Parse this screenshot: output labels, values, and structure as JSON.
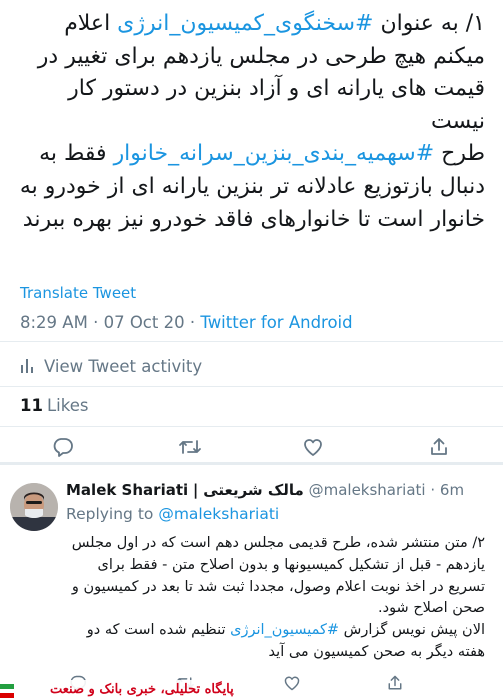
{
  "tweet": {
    "paragraphs": [
      [
        {
          "t": "۱/ به عنوان ",
          "tag": false
        },
        {
          "t": "#سخنگوی_کمیسیون_انرژی",
          "tag": true
        },
        {
          "t": " اعلام میکنم هیچ طرحی در مجلس یازدهم برای تغییر در قیمت های یارانه ای و آزاد بنزین در دستور کار نیست",
          "tag": false
        }
      ],
      [
        {
          "t": "طرح ",
          "tag": false
        },
        {
          "t": "#سهمیه_بندی_بنزین_سرانه_خانوار",
          "tag": true
        },
        {
          "t": " فقط به دنبال بازتوزیع عادلانه تر بنزین یارانه ای از خودرو به خانوار است تا خانوارهای فاقد خودرو نیز بهره ببرند",
          "tag": false
        }
      ]
    ],
    "translate_label": "Translate Tweet",
    "time": "8:29 AM",
    "date": "07 Oct 20",
    "source": "Twitter for Android",
    "activity_label": "View Tweet activity",
    "likes_count": "11",
    "likes_label": "Likes"
  },
  "reply": {
    "name": "Malek Shariati",
    "name_separator": "|",
    "name_fa": "مالک شریعتی",
    "handle": "@malekshariati",
    "age": "6m",
    "replying_to_label": "Replying to",
    "replying_to_handle": "@malekshariati",
    "paragraphs": [
      [
        {
          "t": "۲/ متن منتشر شده، طرح قدیمی مجلس دهم است که در اول مجلس یازدهم - قبل از تشکیل کمیسیونها و بدون اصلاح متن - فقط برای تسریع در اخذ نوبت اعلام وصول، مجددا ثبت شد تا بعد در کمیسیون و صحن اصلاح شود.",
          "tag": false
        }
      ],
      [
        {
          "t": "الان پیش نویس گزارش ",
          "tag": false
        },
        {
          "t": "#کمیسیون_انرژی",
          "tag": true
        },
        {
          "t": " تنظیم شده است که دو هفته دیگر به صحن کمیسیون می آید",
          "tag": false
        }
      ]
    ]
  },
  "watermark": "پایگاه تحلیلی، خبری بانک و صنعت",
  "colors": {
    "link": "#1b95e0",
    "secondary_text": "#657786",
    "primary_text": "#14171a",
    "divider": "#e6ecf0",
    "watermark": "#d0021b"
  },
  "icons": {
    "actions": [
      "reply-icon",
      "retweet-icon",
      "like-icon",
      "share-icon"
    ],
    "activity": "bar-chart-icon"
  }
}
